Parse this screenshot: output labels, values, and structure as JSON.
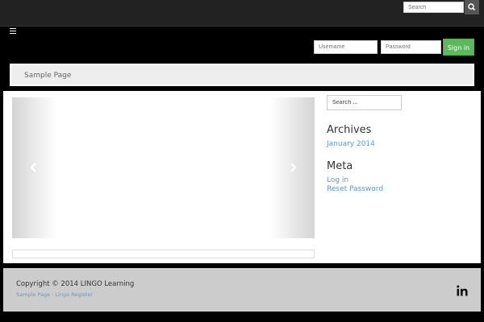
{
  "topbar": {
    "search_placeholder": "Search",
    "search_icon": "search-icon"
  },
  "login": {
    "username_placeholder": "Username",
    "password_placeholder": "Password",
    "signin_label": "Sign in"
  },
  "nav": {
    "items": [
      {
        "label": "Sample Page"
      }
    ]
  },
  "slider": {
    "prev_icon": "chevron-left-icon",
    "next_icon": "chevron-right-icon"
  },
  "sidebar": {
    "search_placeholder": "Search ...",
    "archives_title": "Archives",
    "archives_items": [
      {
        "label": "January 2014"
      }
    ],
    "meta_title": "Meta",
    "meta_items": [
      {
        "label": "Log in"
      },
      {
        "label": "Reset Password"
      }
    ]
  },
  "footer": {
    "copyright": "Copyright © 2014 LINGO Learning",
    "links": [
      {
        "label": "Sample Page"
      },
      {
        "label": "Lingo Register"
      }
    ],
    "social_icon": "linkedin-icon",
    "link_color": "#5a9bd4"
  },
  "colors": {
    "signin_green": "#5cb85c",
    "link_blue": "#5a9bd4"
  }
}
